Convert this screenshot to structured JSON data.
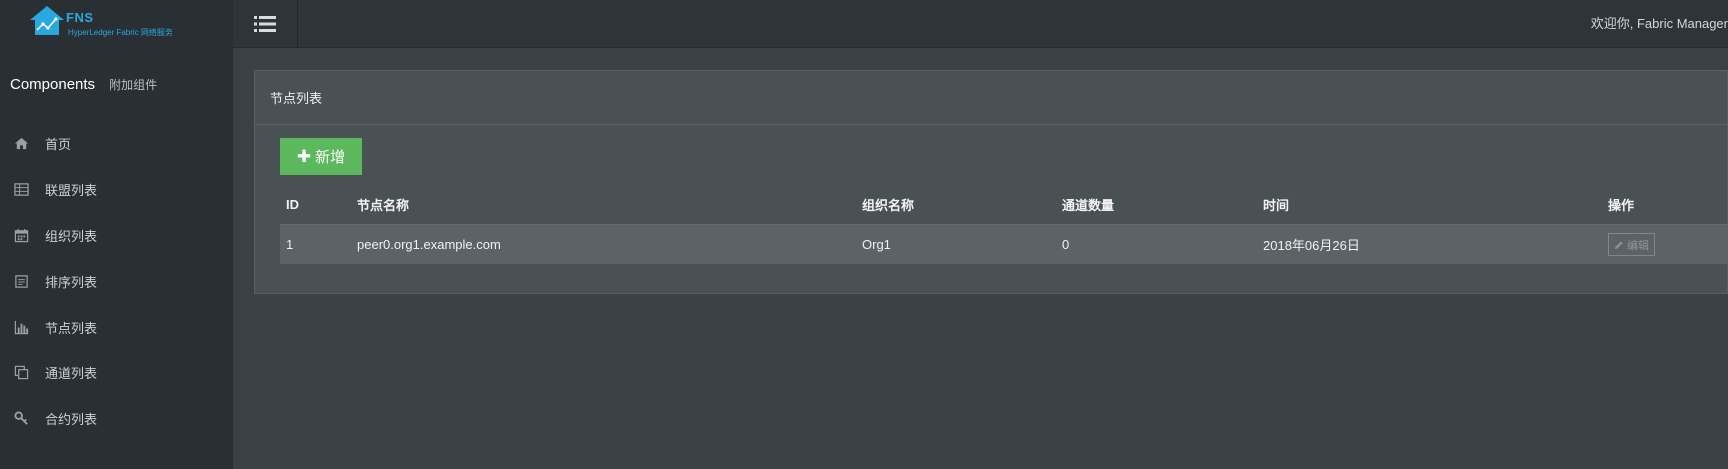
{
  "brand": {
    "name": "FNS",
    "subtitle": "HyperLedger Fabric 网络服务"
  },
  "sidebar": {
    "heading": "Components",
    "subheading": "附加组件",
    "items": [
      {
        "label": "首页",
        "icon": "home-icon"
      },
      {
        "label": "联盟列表",
        "icon": "table-icon"
      },
      {
        "label": "组织列表",
        "icon": "calendar-icon"
      },
      {
        "label": "排序列表",
        "icon": "list-box-icon"
      },
      {
        "label": "节点列表",
        "icon": "bar-chart-icon"
      },
      {
        "label": "通道列表",
        "icon": "copy-icon"
      },
      {
        "label": "合约列表",
        "icon": "key-icon"
      }
    ]
  },
  "topbar": {
    "welcome": "欢迎你, Fabric Manager"
  },
  "panel": {
    "title": "节点列表",
    "add_label": "新增",
    "table": {
      "headers": [
        "ID",
        "节点名称",
        "组织名称",
        "通道数量",
        "时间",
        "操作"
      ],
      "rows": [
        {
          "id": "1",
          "name": "peer0.org1.example.com",
          "org": "Org1",
          "channels": "0",
          "time": "2018年06月26日",
          "action": "编辑"
        }
      ]
    }
  },
  "colors": {
    "accent_blue": "#29a8e0",
    "success_green": "#5cb85c",
    "sidebar_bg": "#2a2f33",
    "content_bg": "#3a4044"
  }
}
